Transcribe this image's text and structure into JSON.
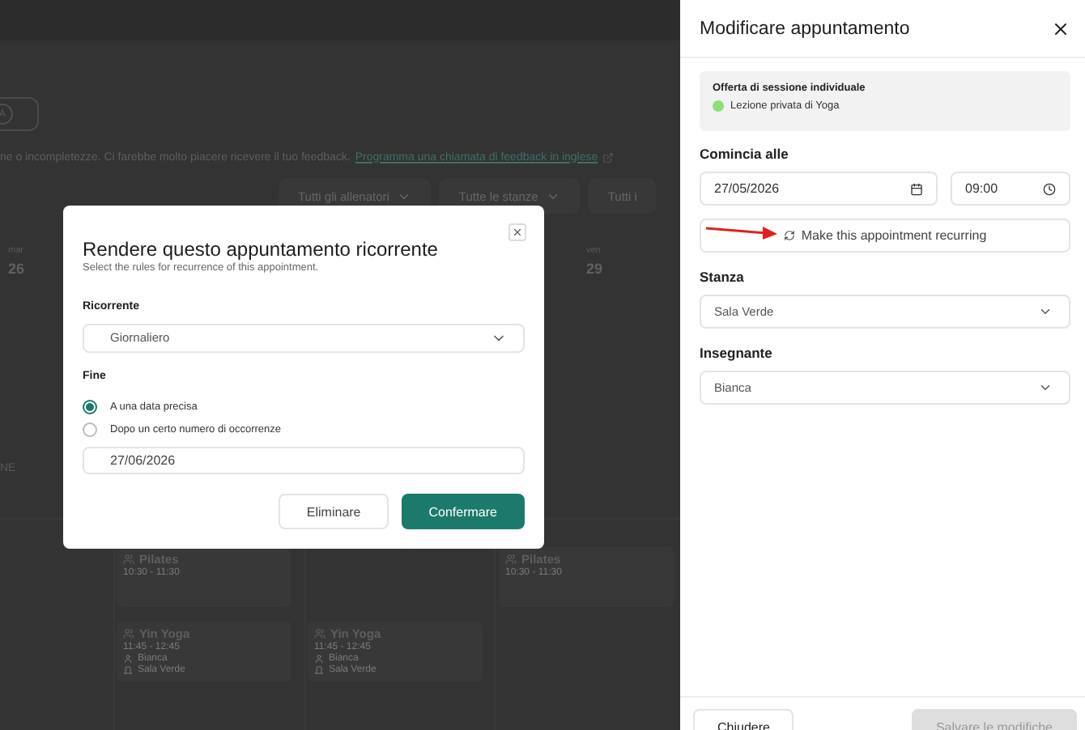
{
  "background": {
    "account_badge": "A",
    "feedback_text": "ne o incompletezze. Ci farebbe molto piacere ricevere il tuo feedback.",
    "feedback_link": "Programma una chiamata di feedback in inglese",
    "filters": [
      "Tutti gli allenatori",
      "Tutte le stanze",
      "Tutti i"
    ],
    "days": [
      {
        "weekday": "mar",
        "date": "26"
      },
      {
        "weekday": "ven",
        "date": "29"
      }
    ],
    "row_label": "NE",
    "events": [
      {
        "title": "Pilates",
        "time": "10:30 - 11:30"
      },
      {
        "title": "Pilates",
        "time": "10:30 - 11:30"
      },
      {
        "title": "Yin Yoga",
        "time": "11:45 - 12:45",
        "trainer": "Bianca",
        "room": "Sala Verde"
      },
      {
        "title": "Yin Yoga",
        "time": "11:45 - 12:45",
        "trainer": "Bianca",
        "room": "Sala Verde"
      }
    ]
  },
  "recurrence_dialog": {
    "title": "Rendere questo appuntamento ricorrente",
    "subtitle": "Select the rules for recurrence of this appointment.",
    "recurrence_label": "Ricorrente",
    "recurrence_value": "Giornaliero",
    "end_label": "Fine",
    "end_options": [
      {
        "label": "A una data precisa",
        "selected": true
      },
      {
        "label": "Dopo un certo numero di occorrenze",
        "selected": false
      }
    ],
    "end_date": "27/06/2026",
    "buttons": [
      {
        "label": "Eliminare",
        "kind": "secondary"
      },
      {
        "label": "Confermare",
        "kind": "primary"
      }
    ]
  },
  "edit_panel": {
    "title": "Modificare appuntamento",
    "offer_label": "Offerta di sessione individuale",
    "offer_name": "Lezione privata di Yoga",
    "start_label": "Comincia alle",
    "start_date": "27/05/2026",
    "start_time": "09:00",
    "recurring_button": "Make this appointment recurring",
    "room_label": "Stanza",
    "room_value": "Sala Verde",
    "teacher_label": "Insegnante",
    "teacher_value": "Bianca",
    "footer": [
      {
        "label": "Chiudere",
        "disabled": false
      },
      {
        "label": "Salvare le modifiche",
        "disabled": true
      }
    ]
  }
}
